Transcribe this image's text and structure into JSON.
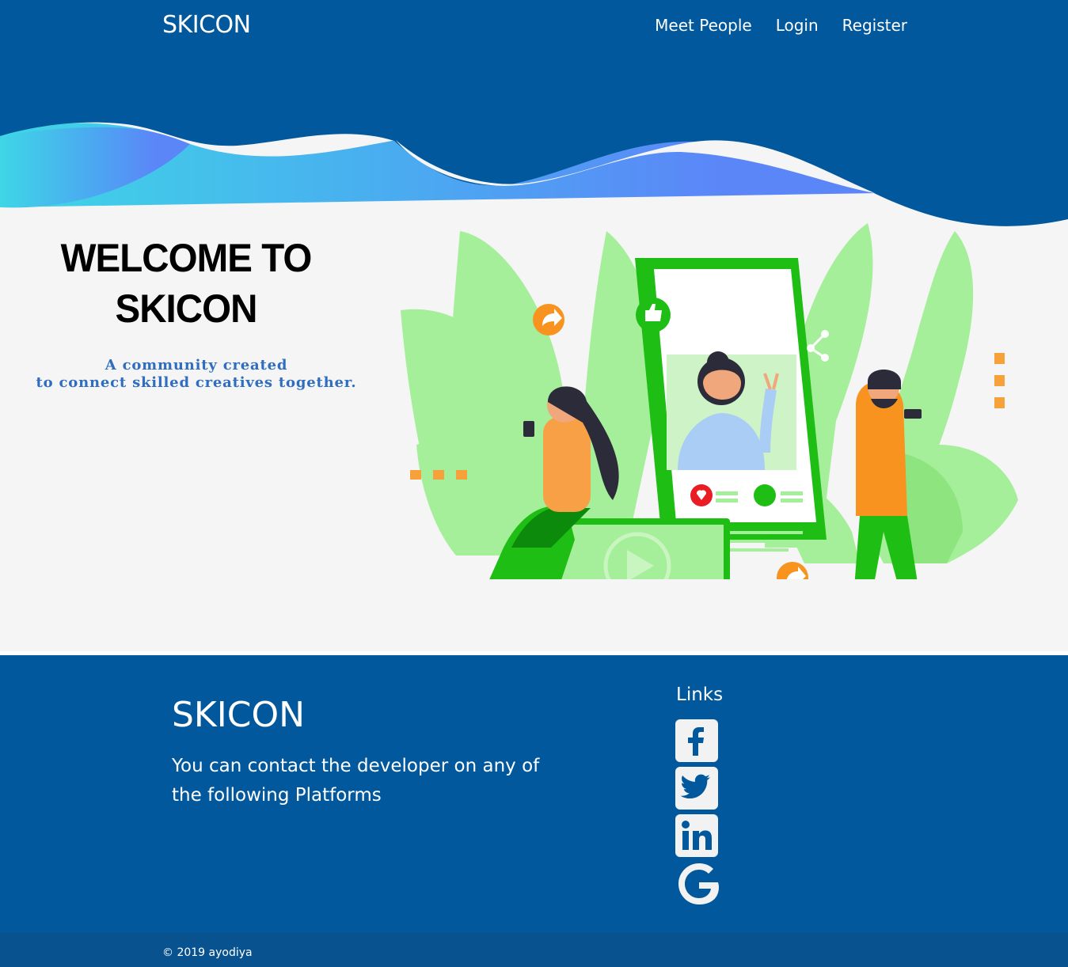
{
  "navbar": {
    "brand": "SKICON",
    "links": [
      {
        "label": "Meet People"
      },
      {
        "label": "Login"
      },
      {
        "label": "Register"
      }
    ]
  },
  "hero": {
    "title_line1": "WELCOME TO",
    "title_line2": "SKICON",
    "tagline_line1": "A community created",
    "tagline_line2": "to connect skilled creatives together."
  },
  "footer": {
    "brand": "SKICON",
    "text": "You can contact the developer on any of the following Platforms",
    "links_title": "Links",
    "social": [
      {
        "icon": "facebook-icon"
      },
      {
        "icon": "twitter-icon"
      },
      {
        "icon": "linkedin-icon"
      },
      {
        "icon": "google-icon"
      }
    ],
    "copyright": "© 2019 ayodiya"
  },
  "colors": {
    "primary": "#02589c",
    "background": "#f5f5f5",
    "tagline": "#2f6dc0",
    "leaf": "#a5ef9a",
    "green": "#1fbe14",
    "orange": "#f7931e"
  }
}
